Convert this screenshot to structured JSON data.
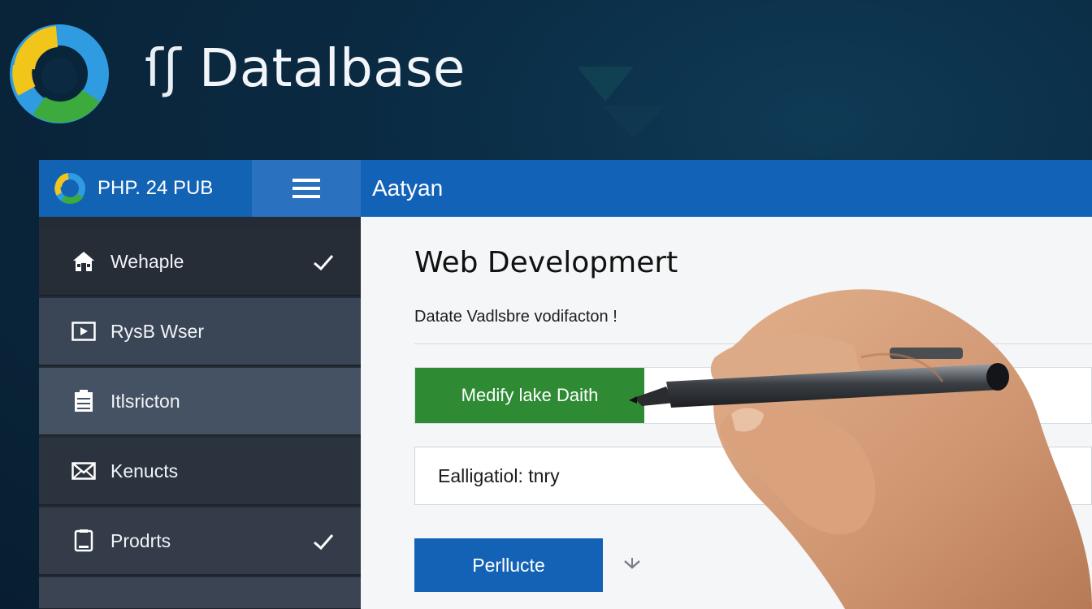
{
  "hero": {
    "mark": "ſʃ",
    "title": "Datalbase",
    "logo_icon": "tricolor-ring-logo"
  },
  "topbar": {
    "brand": "PHP. 24 PUB",
    "menu_icon": "hamburger-icon",
    "page_heading": "Aatyan"
  },
  "sidebar": {
    "items": [
      {
        "label": "Wehaple",
        "icon": "home-icon",
        "checked": true
      },
      {
        "label": "RysB Wser",
        "icon": "video-icon",
        "checked": false
      },
      {
        "label": "Itlsricton",
        "icon": "clipboard-icon",
        "checked": false
      },
      {
        "label": "Kenucts",
        "icon": "mail-icon",
        "checked": false
      },
      {
        "label": "Prodrts",
        "icon": "device-icon",
        "checked": true
      },
      {
        "label": "",
        "icon": "",
        "checked": false
      }
    ]
  },
  "main": {
    "title": "Web Developmert",
    "subtitle": "Datate Vadlsbre vodifacton !",
    "green_button": "Medify lake Daith",
    "field_value": "Ealligatiol: tnry",
    "blue_button": "Perllucte"
  },
  "colors": {
    "topbar": "#1263b8",
    "sidebar": "#252c36",
    "green": "#2e8b34",
    "blue_button": "#1362b5",
    "background": "#0a2a42"
  }
}
